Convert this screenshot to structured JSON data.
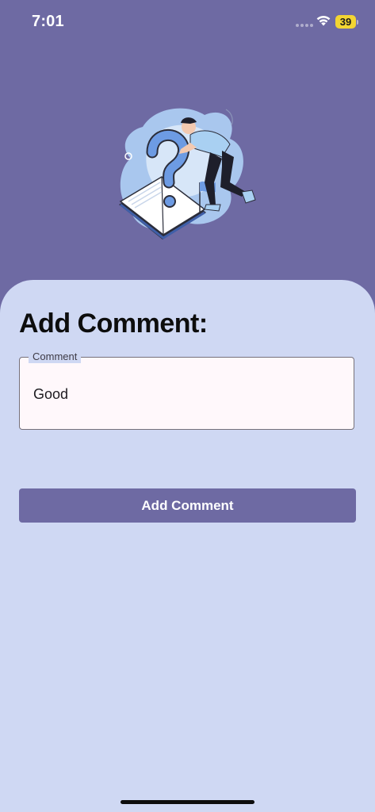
{
  "status_bar": {
    "time": "7:01",
    "battery": "39"
  },
  "illustration": {
    "icon": "question-book-illustration"
  },
  "form": {
    "title": "Add Comment:",
    "comment_label": "Comment",
    "comment_value": "Good",
    "submit_label": "Add Comment"
  },
  "colors": {
    "header_bg": "#6E6AA3",
    "sheet_bg": "#CFD8F3",
    "button_bg": "#6E6AA3",
    "battery": "#F3D532"
  }
}
